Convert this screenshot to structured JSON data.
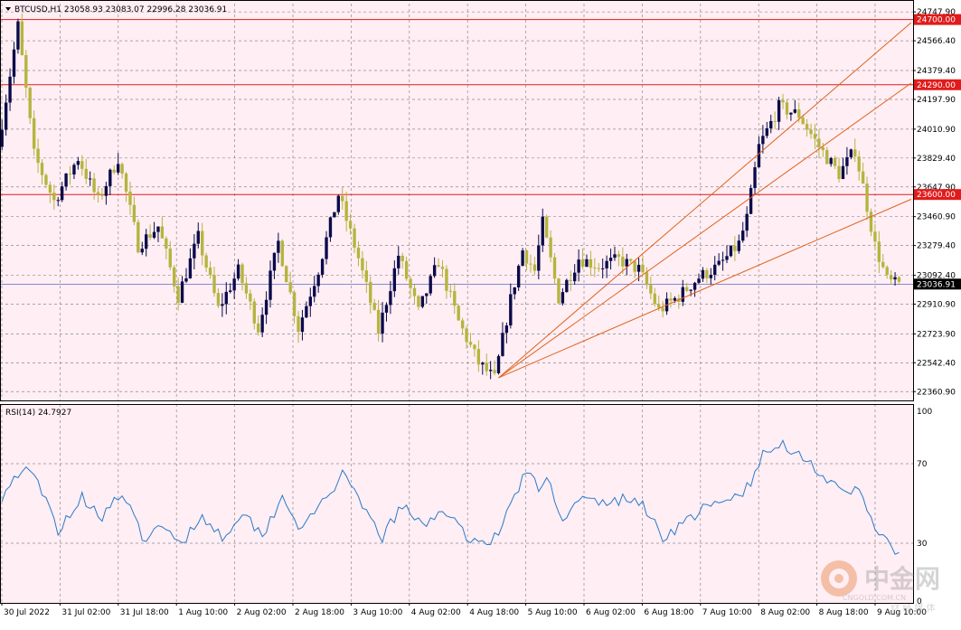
{
  "header": {
    "symbol_line": "BTCUSD,H1  23058.93 23083.07 22996.28 23036.91"
  },
  "rsi_header": "RSI(14) 24.7927",
  "colors": {
    "background": "#ffeef4",
    "grid": "#8c8c8c",
    "bull": "#0a0a4a",
    "bear": "#b5b43e",
    "level": "#e11b1b",
    "trend": "#e0631a",
    "rsi": "#2a7ac8",
    "current": "#3b4fc4",
    "price_tag_current_bg": "#000000"
  },
  "watermark": {
    "title": "中金网",
    "subtitle": "CNGOLD.COM.CN",
    "tag": "财 经 媒 体"
  },
  "chart_data": [
    {
      "type": "candlestick",
      "symbol": "BTCUSD",
      "timeframe": "H1",
      "ylim": [
        22300,
        24800
      ],
      "y_ticks": [
        24747.9,
        24566.4,
        24379.4,
        24197.9,
        24010.9,
        23829.4,
        23647.9,
        23460.9,
        23279.4,
        23092.4,
        22910.9,
        22723.9,
        22542.4,
        22360.9
      ],
      "x_tick_labels": [
        "30 Jul 2022",
        "31 Jul 02:00",
        "31 Jul 18:00",
        "1 Aug 10:00",
        "2 Aug 02:00",
        "2 Aug 18:00",
        "3 Aug 10:00",
        "4 Aug 02:00",
        "4 Aug 18:00",
        "5 Aug 10:00",
        "6 Aug 02:00",
        "6 Aug 18:00",
        "7 Aug 10:00",
        "8 Aug 02:00",
        "8 Aug 18:00",
        "9 Aug 10:00"
      ],
      "path": [
        [
          0,
          23900
        ],
        [
          5,
          24660
        ],
        [
          9,
          23850
        ],
        [
          14,
          23560
        ],
        [
          20,
          23830
        ],
        [
          25,
          23560
        ],
        [
          30,
          23830
        ],
        [
          35,
          23280
        ],
        [
          40,
          23400
        ],
        [
          45,
          22960
        ],
        [
          50,
          23330
        ],
        [
          55,
          22880
        ],
        [
          60,
          23120
        ],
        [
          65,
          22760
        ],
        [
          70,
          23300
        ],
        [
          75,
          22760
        ],
        [
          80,
          23130
        ],
        [
          85,
          23600
        ],
        [
          90,
          23200
        ],
        [
          95,
          22740
        ],
        [
          100,
          23220
        ],
        [
          105,
          22860
        ],
        [
          110,
          23180
        ],
        [
          115,
          22800
        ],
        [
          120,
          22540
        ],
        [
          124,
          22440
        ],
        [
          128,
          22940
        ],
        [
          131,
          23250
        ],
        [
          134,
          23120
        ],
        [
          136,
          23420
        ],
        [
          140,
          22950
        ],
        [
          145,
          23200
        ],
        [
          150,
          23150
        ],
        [
          155,
          23190
        ],
        [
          160,
          23130
        ],
        [
          165,
          22870
        ],
        [
          170,
          22960
        ],
        [
          175,
          23080
        ],
        [
          180,
          23150
        ],
        [
          185,
          23290
        ],
        [
          187,
          23450
        ],
        [
          190,
          23900
        ],
        [
          195,
          24150
        ],
        [
          200,
          24100
        ],
        [
          205,
          23900
        ],
        [
          210,
          23730
        ],
        [
          214,
          23880
        ],
        [
          216,
          23650
        ],
        [
          219,
          23280
        ],
        [
          222,
          23060
        ],
        [
          224,
          23037
        ]
      ],
      "levels": [
        24700.0,
        24290.0,
        23600.0
      ],
      "level_labels": [
        "24700.00",
        "24290.00",
        "23600.00"
      ],
      "current_price": 23036.91,
      "current_label": "23036.91",
      "trendlines": [
        {
          "from": [
            124,
            22448
          ],
          "to": [
            227,
            24680
          ]
        },
        {
          "from": [
            124,
            22448
          ],
          "to": [
            227,
            24300
          ]
        },
        {
          "from": [
            124,
            22448
          ],
          "to": [
            227,
            23570
          ]
        }
      ]
    },
    {
      "type": "line",
      "name": "RSI(14)",
      "ylim": [
        0,
        100
      ],
      "y_ticks": [
        100,
        70,
        30,
        0
      ],
      "current": 24.7927,
      "path": [
        [
          0,
          54
        ],
        [
          5,
          68
        ],
        [
          9,
          60
        ],
        [
          14,
          37
        ],
        [
          20,
          53
        ],
        [
          25,
          44
        ],
        [
          30,
          55
        ],
        [
          35,
          33
        ],
        [
          40,
          37
        ],
        [
          45,
          31
        ],
        [
          50,
          44
        ],
        [
          55,
          33
        ],
        [
          60,
          46
        ],
        [
          65,
          34
        ],
        [
          70,
          54
        ],
        [
          75,
          36
        ],
        [
          80,
          51
        ],
        [
          85,
          64
        ],
        [
          90,
          48
        ],
        [
          95,
          33
        ],
        [
          100,
          49
        ],
        [
          105,
          38
        ],
        [
          110,
          48
        ],
        [
          115,
          35
        ],
        [
          120,
          30
        ],
        [
          124,
          34
        ],
        [
          128,
          55
        ],
        [
          131,
          66
        ],
        [
          134,
          57
        ],
        [
          136,
          63
        ],
        [
          140,
          43
        ],
        [
          145,
          52
        ],
        [
          150,
          50
        ],
        [
          155,
          52
        ],
        [
          160,
          50
        ],
        [
          165,
          33
        ],
        [
          170,
          40
        ],
        [
          175,
          47
        ],
        [
          180,
          50
        ],
        [
          185,
          56
        ],
        [
          187,
          60
        ],
        [
          190,
          74
        ],
        [
          195,
          80
        ],
        [
          200,
          74
        ],
        [
          205,
          64
        ],
        [
          210,
          54
        ],
        [
          214,
          57
        ],
        [
          216,
          48
        ],
        [
          219,
          35
        ],
        [
          222,
          27
        ],
        [
          224,
          25
        ]
      ]
    }
  ]
}
